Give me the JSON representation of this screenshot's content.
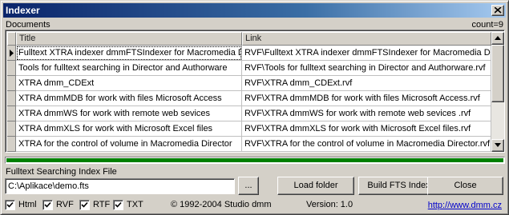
{
  "window": {
    "title": "Indexer",
    "close_icon": "close-icon"
  },
  "documents": {
    "label": "Documents",
    "count": "count=9",
    "columns": [
      "Title",
      "Link"
    ],
    "rows": [
      {
        "title": "Fulltext XTRA indexer dmmFTSIndexer for Macromedia Director",
        "link": "RVF\\Fulltext XTRA indexer dmmFTSIndexer for Macromedia Director.rvf"
      },
      {
        "title": "Tools for fulltext searching in Director and Authorware",
        "link": "RVF\\Tools for fulltext searching in Director and Authorware.rvf"
      },
      {
        "title": "XTRA dmm_CDExt",
        "link": "RVF\\XTRA dmm_CDExt.rvf"
      },
      {
        "title": "XTRA dmmMDB for work with files Microsoft Access",
        "link": "RVF\\XTRA dmmMDB for work with files Microsoft Access.rvf"
      },
      {
        "title": "XTRA dmmWS for work with remote web sevices",
        "link": "RVF\\XTRA dmmWS for work with remote web sevices .rvf"
      },
      {
        "title": "XTRA dmmXLS for work with Microsoft Excel files",
        "link": "RVF\\XTRA dmmXLS for work with Microsoft Excel files.rvf"
      },
      {
        "title": "XTRA for the control of volume in Macromedia Director",
        "link": "RVF\\XTRA for the control of volume in Macromedia Director.rvf"
      }
    ],
    "selected_row": 0,
    "current_row_icon": "triangle-right-icon"
  },
  "progress": {
    "fraction": 1.0,
    "color": "#008000"
  },
  "index_file": {
    "label": "Fulltext Searching Index File",
    "value": "C:\\Aplikace\\demo.fts",
    "browse_label": "..."
  },
  "buttons": {
    "load_folder": "Load folder",
    "build_fts_index": "Build FTS Index",
    "close": "Close"
  },
  "filters": [
    {
      "label": "Html",
      "checked": true
    },
    {
      "label": "RVF",
      "checked": true
    },
    {
      "label": "RTF",
      "checked": true
    },
    {
      "label": "TXT",
      "checked": true
    }
  ],
  "footer": {
    "copyright": "© 1992-2004 Studio dmm",
    "version": "Version: 1.0",
    "website": "http://www.dmm.cz"
  }
}
